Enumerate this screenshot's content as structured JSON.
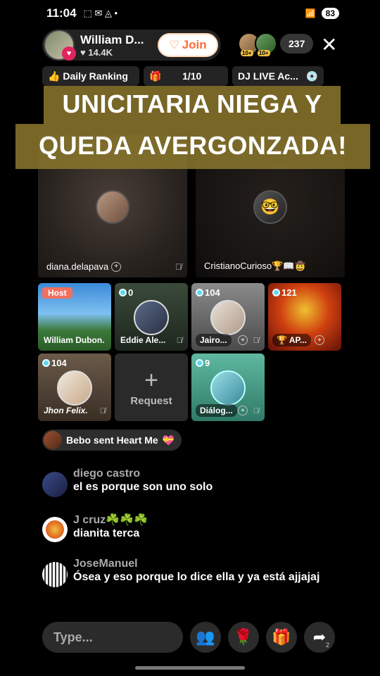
{
  "status": {
    "time": "11:04",
    "battery": "83"
  },
  "host": {
    "name": "William D...",
    "likes": "14.4K",
    "join_label": "Join"
  },
  "viewers": {
    "count": "237",
    "rank_badge_1": "10+",
    "rank_badge_2": "10+"
  },
  "info": {
    "ranking_label": "Daily Ranking",
    "goal_progress": "1/10",
    "dj_label": "DJ LIVE Ac..."
  },
  "headline": {
    "line1": "UNICITARIA NIEGA Y",
    "line2": "QUEDA AVERGONZADA!"
  },
  "big_tiles": [
    {
      "name": "diana.delapava",
      "icon": "microphone-off-icon"
    },
    {
      "name": "CristianoCurioso🏆📖🤠",
      "icon": "microphone-off-icon"
    }
  ],
  "small_tiles": {
    "host_label": "Host",
    "william_name": "William Dubon.",
    "eddie": {
      "count": "0",
      "name": "Eddie Ale..."
    },
    "jairo": {
      "count": "104",
      "name": "Jairo..."
    },
    "ap": {
      "count": "121",
      "name": "AP..."
    },
    "jhon": {
      "count": "104",
      "name": "Jhon Felix."
    },
    "request_label": "Request",
    "dialog": {
      "count": "9",
      "name": "Diálog..."
    }
  },
  "gift": {
    "text": "Bebo sent Heart Me"
  },
  "comments": [
    {
      "user": "diego castro",
      "text": "el es porque son uno solo"
    },
    {
      "user": "J cruz☘️☘️☘️",
      "text": "dianita terca"
    },
    {
      "user": "JoseManuel",
      "text": "Ósea y eso porque lo dice ella y ya está ajjajaj"
    }
  ],
  "bottom": {
    "placeholder": "Type...",
    "share_count": "2"
  },
  "colors": {
    "headline_bg": "#8c782d",
    "join_text": "#ff6b35",
    "count_dot": "#5fd7f0"
  }
}
